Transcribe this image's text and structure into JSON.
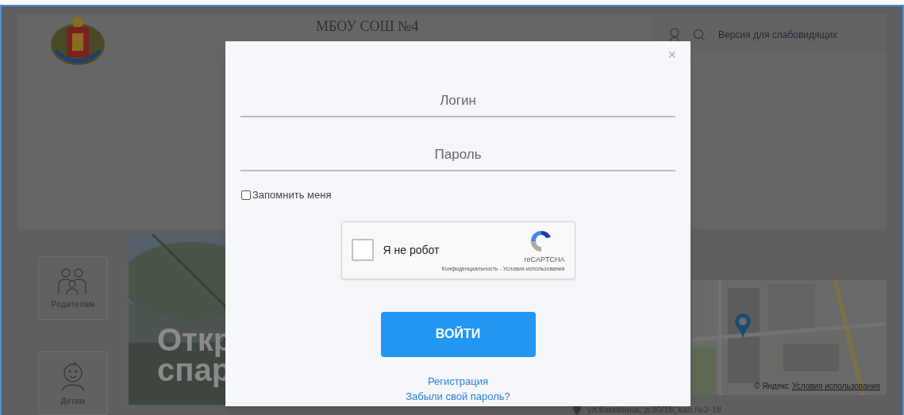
{
  "header": {
    "title": "МБОУ СОШ №4",
    "accessibility_link": "Версия для слабовидящих"
  },
  "sidebar": [
    {
      "kind": "family",
      "label": "Родителям"
    },
    {
      "kind": "child",
      "label": "Детям"
    }
  ],
  "hero": {
    "lines": [
      "Откр",
      "спар"
    ]
  },
  "map": {
    "attribution": "© Яндекс",
    "terms_link": "Условия использования"
  },
  "address": "ул.Каманина, д.30/18, каб.№2-18",
  "login_dialog": {
    "close": "×",
    "fields": [
      {
        "placeholder": "Логин"
      },
      {
        "placeholder": "Пароль"
      }
    ],
    "remember": {
      "label": "Запомнить меня",
      "checked": false
    },
    "captcha": {
      "label": "Я не робот",
      "checked": false,
      "brand": "reCAPTCHA",
      "privacy": "Конфиденциальность",
      "separator": "-",
      "terms": "Условия использования"
    },
    "submit": "ВОЙТИ",
    "links": [
      "Регистрация",
      "Забыли свой пароль?"
    ]
  }
}
